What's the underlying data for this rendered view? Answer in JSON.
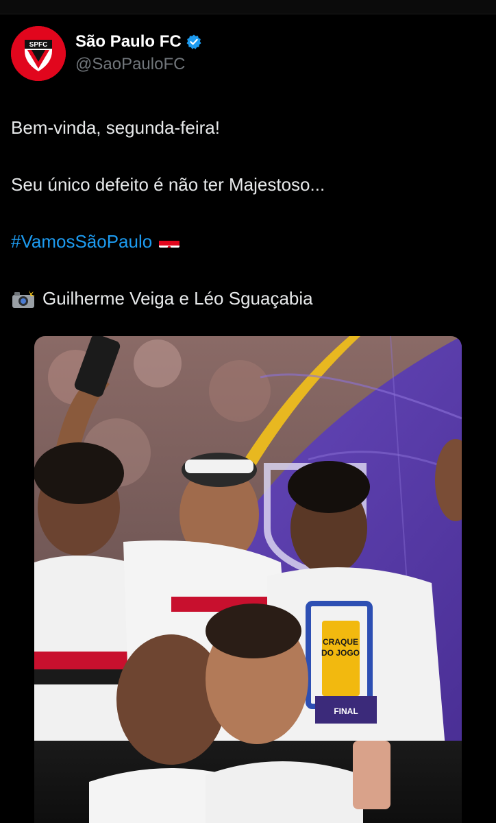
{
  "account": {
    "avatar_text": "SPFC",
    "display_name": "São Paulo FC",
    "handle": "@SaoPauloFC",
    "verified_icon": "verified-badge-icon"
  },
  "tweet": {
    "line1": "Bem-vinda, segunda-feira!",
    "line2": "Seu único defeito é não ter Majestoso...",
    "hashtag": "#VamosSãoPaulo",
    "flag_icon": "spfc-flag-icon",
    "camera_icon": "camera-flash-icon",
    "credits": "Guilherme Veiga e Léo Sguaçabia"
  },
  "media": {
    "trophy_line1": "CRAQUE",
    "trophy_line2": "DO JOGO",
    "trophy_base": "FINAL"
  },
  "colors": {
    "background": "#000000",
    "text": "#e7e9ea",
    "handle": "#71767b",
    "link": "#1d9bf0",
    "spfc_red": "#e1061d",
    "stage_purple": "#5b3fa8",
    "gold_ribbon": "#e8b820"
  }
}
